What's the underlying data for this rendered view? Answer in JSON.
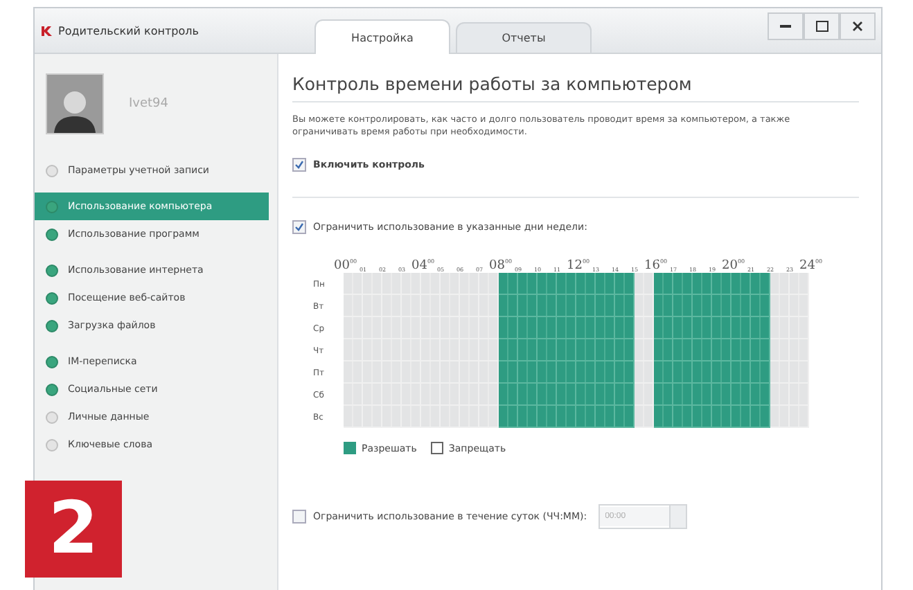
{
  "window": {
    "title": "Родительский контроль"
  },
  "tabs": [
    {
      "label": "Настройка",
      "selected": true
    },
    {
      "label": "Отчеты",
      "selected": false
    }
  ],
  "user": {
    "name": "Ivet94"
  },
  "sidebar": {
    "groups": [
      [
        {
          "label": "Параметры учетной записи",
          "on": false,
          "selected": false
        }
      ],
      [
        {
          "label": "Использование компьютера",
          "on": true,
          "selected": true
        },
        {
          "label": "Использование программ",
          "on": true,
          "selected": false
        }
      ],
      [
        {
          "label": "Использование интернета",
          "on": true,
          "selected": false
        },
        {
          "label": "Посещение веб-сайтов",
          "on": true,
          "selected": false
        },
        {
          "label": "Загрузка файлов",
          "on": true,
          "selected": false
        }
      ],
      [
        {
          "label": "IM-переписка",
          "on": true,
          "selected": false
        },
        {
          "label": "Социальные сети",
          "on": true,
          "selected": false
        },
        {
          "label": "Личные данные",
          "on": false,
          "selected": false
        },
        {
          "label": "Ключевые слова",
          "on": false,
          "selected": false
        }
      ]
    ]
  },
  "step_badge": "2",
  "content": {
    "heading": "Контроль времени работы за компьютером",
    "description": "Вы можете контролировать, как часто и долго пользователь проводит время за компьютером, а также ограничивать время работы при необходимости.",
    "enable": {
      "label": "Включить контроль",
      "checked": true
    },
    "days_limit": {
      "label": "Ограничить использование в указанные дни недели:",
      "checked": true
    },
    "hours": [
      {
        "kind": "major",
        "text": "00",
        "sup": "00"
      },
      {
        "kind": "minor",
        "text": "01"
      },
      {
        "kind": "minor",
        "text": "02"
      },
      {
        "kind": "minor",
        "text": "03"
      },
      {
        "kind": "major",
        "text": "04",
        "sup": "00"
      },
      {
        "kind": "minor",
        "text": "05"
      },
      {
        "kind": "minor",
        "text": "06"
      },
      {
        "kind": "minor",
        "text": "07"
      },
      {
        "kind": "major",
        "text": "08",
        "sup": "00"
      },
      {
        "kind": "minor",
        "text": "09"
      },
      {
        "kind": "minor",
        "text": "10"
      },
      {
        "kind": "minor",
        "text": "11"
      },
      {
        "kind": "major",
        "text": "12",
        "sup": "00"
      },
      {
        "kind": "minor",
        "text": "13"
      },
      {
        "kind": "minor",
        "text": "14"
      },
      {
        "kind": "minor",
        "text": "15"
      },
      {
        "kind": "major",
        "text": "16",
        "sup": "00"
      },
      {
        "kind": "minor",
        "text": "17"
      },
      {
        "kind": "minor",
        "text": "18"
      },
      {
        "kind": "minor",
        "text": "19"
      },
      {
        "kind": "major",
        "text": "20",
        "sup": "00"
      },
      {
        "kind": "minor",
        "text": "21"
      },
      {
        "kind": "minor",
        "text": "22"
      },
      {
        "kind": "minor",
        "text": "23"
      },
      {
        "kind": "major",
        "text": "24",
        "sup": "00"
      }
    ],
    "days": [
      {
        "label": "Пн",
        "allowed": [
          false,
          false,
          false,
          false,
          false,
          false,
          false,
          false,
          true,
          true,
          true,
          true,
          true,
          true,
          true,
          false,
          true,
          true,
          true,
          true,
          true,
          true,
          false,
          false
        ]
      },
      {
        "label": "Вт",
        "allowed": [
          false,
          false,
          false,
          false,
          false,
          false,
          false,
          false,
          true,
          true,
          true,
          true,
          true,
          true,
          true,
          false,
          true,
          true,
          true,
          true,
          true,
          true,
          false,
          false
        ]
      },
      {
        "label": "Ср",
        "allowed": [
          false,
          false,
          false,
          false,
          false,
          false,
          false,
          false,
          true,
          true,
          true,
          true,
          true,
          true,
          true,
          false,
          true,
          true,
          true,
          true,
          true,
          true,
          false,
          false
        ]
      },
      {
        "label": "Чт",
        "allowed": [
          false,
          false,
          false,
          false,
          false,
          false,
          false,
          false,
          true,
          true,
          true,
          true,
          true,
          true,
          true,
          false,
          true,
          true,
          true,
          true,
          true,
          true,
          false,
          false
        ]
      },
      {
        "label": "Пт",
        "allowed": [
          false,
          false,
          false,
          false,
          false,
          false,
          false,
          false,
          true,
          true,
          true,
          true,
          true,
          true,
          true,
          false,
          true,
          true,
          true,
          true,
          true,
          true,
          false,
          false
        ]
      },
      {
        "label": "Сб",
        "allowed": [
          false,
          false,
          false,
          false,
          false,
          false,
          false,
          false,
          true,
          true,
          true,
          true,
          true,
          true,
          true,
          false,
          true,
          true,
          true,
          true,
          true,
          true,
          false,
          false
        ]
      },
      {
        "label": "Вс",
        "allowed": [
          false,
          false,
          false,
          false,
          false,
          false,
          false,
          false,
          true,
          true,
          true,
          true,
          true,
          true,
          true,
          false,
          true,
          true,
          true,
          true,
          true,
          true,
          false,
          false
        ]
      }
    ],
    "legend": [
      {
        "label": "Разрешать",
        "allowed": true
      },
      {
        "label": "Запрещать",
        "allowed": false
      }
    ],
    "daily_limit": {
      "label": "Ограничить использование в течение суток (ЧЧ:ММ):",
      "checked": false,
      "value": "00:00",
      "disabled": true
    }
  }
}
